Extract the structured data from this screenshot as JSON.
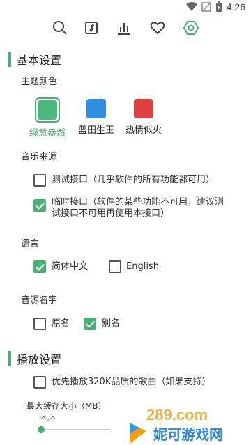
{
  "statusbar": {
    "time": "4:26"
  },
  "tabs": [
    {
      "icon": "search-icon"
    },
    {
      "icon": "music-file-icon"
    },
    {
      "icon": "chart-icon"
    },
    {
      "icon": "heart-icon"
    },
    {
      "icon": "settings-icon"
    }
  ],
  "basic": {
    "title": "基本设置",
    "theme_label": "主题颜色",
    "themes": [
      {
        "name": "绿意盎然",
        "color": "#4cb77c",
        "selected": true
      },
      {
        "name": "蓝田生玉",
        "color": "#2e8fde",
        "selected": false
      },
      {
        "name": "热情似火",
        "color": "#e04040",
        "selected": false
      }
    ],
    "source_label": "音乐来源",
    "sources": [
      {
        "line1": "测试接口（几乎软件的所有功能都可用）",
        "line2": "",
        "checked": false
      },
      {
        "line1": "临时接口（软件的某些功能不可用，建议测",
        "line2": "试接口不可用再使用本接口）",
        "checked": true
      }
    ],
    "language_label": "语言",
    "languages": [
      {
        "name": "简体中文",
        "checked": true
      },
      {
        "name": "English",
        "checked": false
      }
    ],
    "srcname_label": "音源名字",
    "srcnames": [
      {
        "name": "原名",
        "checked": false
      },
      {
        "name": "别名",
        "checked": true
      }
    ]
  },
  "play": {
    "title": "播放设置",
    "prefer320": {
      "label": "优先播放320K品质的歌曲（如果支持）",
      "checked": false
    },
    "cache_label": "最大缓存大小（MB）",
    "cache_hint": "^-^",
    "cache_value": 0
  },
  "watermark": {
    "site": "289.com",
    "brand": "妮可游戏网"
  },
  "colors": {
    "accent": "#4caf76"
  }
}
